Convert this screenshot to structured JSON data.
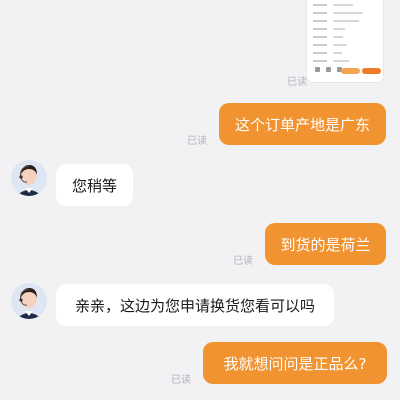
{
  "read_status": "已读",
  "messages": [
    {
      "side": "out",
      "text": "这个订单产地是广东"
    },
    {
      "side": "in",
      "text": "您稍等"
    },
    {
      "side": "out",
      "text": "到货的是荷兰"
    },
    {
      "side": "in",
      "text": "亲亲，这边为您申请换货您看可以吗"
    },
    {
      "side": "out",
      "text": "我就想问问是正品么?"
    }
  ],
  "colors": {
    "background": "#f2f2f4",
    "outgoing_bubble": "#f09330",
    "incoming_bubble": "#ffffff",
    "read_label": "#b3b3b8"
  },
  "icons": [
    "agent-avatar-icon",
    "screenshot-thumbnail"
  ]
}
